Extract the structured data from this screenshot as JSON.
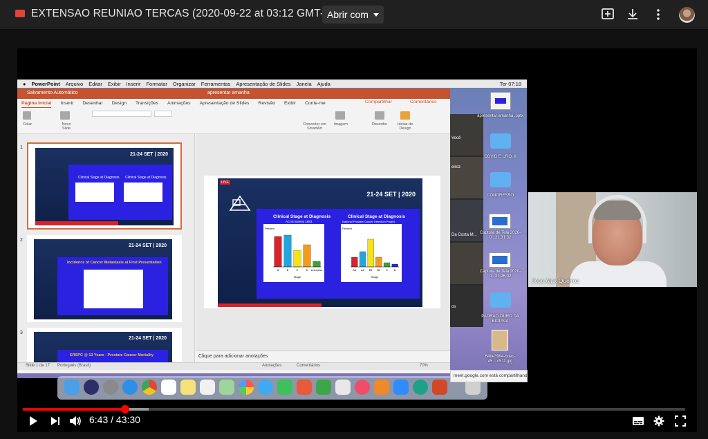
{
  "viewer": {
    "title": "EXTENSAO REUNIAO TERCAS (2020-09-22 at 03:12 GMT-7)",
    "open_with": "Abrir com"
  },
  "mac_menu": {
    "app": "PowerPoint",
    "items": [
      "Arquivo",
      "Editar",
      "Exibir",
      "Inserir",
      "Formatar",
      "Organizar",
      "Ferramentas",
      "Apresentação de Slides",
      "Janela",
      "Ajuda"
    ],
    "clock": "Ter 07:18"
  },
  "ppt": {
    "autosave": "Salvamento Automático",
    "doc_title": "apresentar amanha",
    "tabs": [
      "Página Inicial",
      "Inserir",
      "Desenhar",
      "Design",
      "Transições",
      "Animações",
      "Apresentação de Slides",
      "Revisão",
      "Exibir",
      "Conte-me"
    ],
    "share": "Compartilhar",
    "comments": "Comentários",
    "ribbon": {
      "paste": "Colar",
      "new_slide": "Novo Slide",
      "image": "Imagem",
      "convert": "Converter em SmartArt",
      "draw": "Desenho",
      "ideas": "Ideias de Design"
    },
    "notes_placeholder": "Clique para adicionar anotações",
    "status": {
      "slide": "Slide 1 de 17",
      "lang": "Português (Brasil)",
      "notes": "Anotações",
      "comments": "Comentários",
      "zoom": "70%"
    },
    "slides": [
      {
        "num": "1",
        "header": "21-24 SET | 2020",
        "left_title": "Clinical Stage at Diagnosis",
        "left_sub": "ACoS Survey 1983",
        "right_title": "Clinical Stage at Diagnosis",
        "right_sub": "National Prostate Cancer Detection Project"
      },
      {
        "num": "2",
        "header": "21-24 SET | 2020",
        "title": "Incidence of Cancer Metastasis at First Presentation"
      },
      {
        "num": "3",
        "header": "21-24 SET | 2020",
        "title": "ERSPC @ 13 Years - Prostate Cancer Mortality"
      }
    ],
    "main_slide": {
      "live": "LIVE",
      "header": "21-24 SET | 2020",
      "left_title": "Clinical Stage at Diagnosis",
      "left_sub": "ACoS Survey 1983",
      "left_ylabel": "Percent",
      "left_xlabel": "Stage",
      "left_cats": [
        "A",
        "B",
        "C",
        "D",
        "Unknown"
      ],
      "left_values": [
        44,
        46,
        24,
        32,
        8
      ],
      "left_colors": [
        "#d8232a",
        "#1fa6e0",
        "#f5e21b",
        "#f29b1d",
        "#3aa33a"
      ],
      "right_title": "Clinical Stage at Diagnosis",
      "right_sub": "National Prostate Cancer Detection Project",
      "right_year": "1992",
      "right_ylabel": "Percent",
      "right_xlabel": "Stage",
      "right_cats": [
        "A1",
        "A2",
        "B1",
        "B2",
        "C",
        "D"
      ],
      "right_values": [
        14,
        22,
        40,
        14,
        6,
        4
      ],
      "right_colors": [
        "#d8232a",
        "#1fa6e0",
        "#f5e21b",
        "#f29b1d",
        "#3aa33a",
        "#2a22e0"
      ]
    }
  },
  "desktop_icons": [
    {
      "label": "apresentar amanha .pptx"
    },
    {
      "label": "COVID E URO. II"
    },
    {
      "label": "CONGRESSO"
    },
    {
      "label": "Captura de Tela 2020-0...21.31.32"
    },
    {
      "label": "Captura de Tela 2020-0...21.26.02"
    },
    {
      "label": "PADRAO OURO DA BIOPSIA"
    },
    {
      "label": "64be3994-bdec-45....c511.jpg"
    }
  ],
  "meet_tiles": [
    "Você",
    "eiroz",
    "Da Costa M...",
    "os"
  ],
  "notification": "meet.google.com está compartilhando",
  "speaker_name": "Jose Ajax Queiroz",
  "player": {
    "time": "6:43 / 43:30",
    "progress": 0.154,
    "buffered": 0.19
  }
}
